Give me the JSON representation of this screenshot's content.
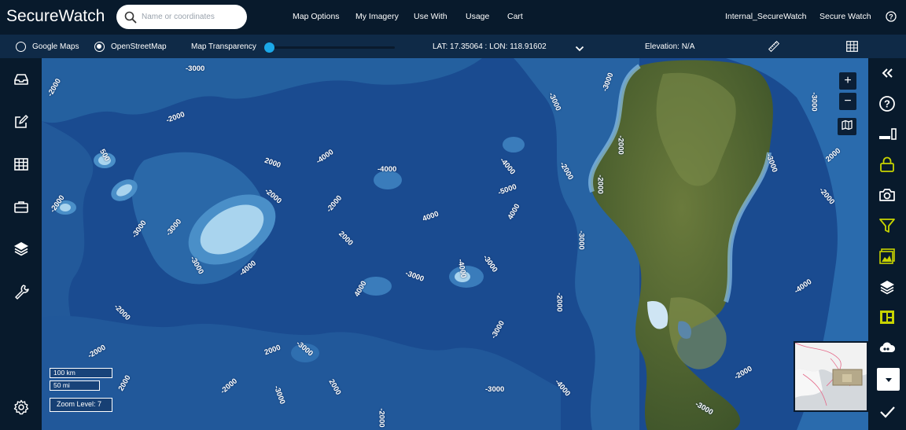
{
  "app": {
    "logo": "SecureWatch"
  },
  "search": {
    "placeholder": "Name or coordinates"
  },
  "nav": {
    "items": [
      "Map Options",
      "My Imagery",
      "Use With",
      "Usage",
      "Cart"
    ],
    "account": "Internal_SecureWatch",
    "product": "Secure Watch"
  },
  "toolbar": {
    "basemap_google": "Google Maps",
    "basemap_osm": "OpenStreetMap",
    "selected_basemap": "OpenStreetMap",
    "transparency_label": "Map Transparency",
    "transparency_value": 0.02,
    "coordinates": "LAT: 17.35064 : LON: 118.91602",
    "elevation": "Elevation: N/A"
  },
  "map": {
    "zoom_in": "+",
    "zoom_out": "−",
    "scale_km": "100 km",
    "scale_mi": "50 mi",
    "zoom_level": "Zoom Level: 7",
    "contours": [
      "-3000",
      "-2000",
      "-2000",
      "500",
      "-2000",
      "-3000",
      "-2000",
      "2000",
      "-4000",
      "-4000",
      "-2000",
      "-3000",
      "4000",
      "-4000",
      "-3000",
      "4000",
      "-4000",
      "-2000",
      "-2000",
      "4000",
      "-3000",
      "-4000",
      "-3000",
      "-3000",
      "-2000",
      "-3000",
      "-2000",
      "-3000",
      "-2000",
      "-3000",
      "2000",
      "-3000",
      "-2000",
      "-4000",
      "2000",
      "-3000",
      "-2000",
      "2000",
      "-3000",
      "2000",
      "-3000",
      "-4000",
      "-3000",
      "-2000",
      "-5000",
      "-2000",
      "-2000",
      "-3000",
      "2000"
    ]
  },
  "colors": {
    "topbar": "#081a2c",
    "toolbar": "#0f2a47",
    "accent": "#1ba8e8",
    "highlight": "#c8d400",
    "ocean_deep": "#1b4d92"
  },
  "icons": {
    "left": [
      "inbox-icon",
      "edit-icon",
      "table-icon",
      "briefcase-icon",
      "layers-icon",
      "wrench-icon",
      "gear-icon"
    ],
    "right": [
      "double-chevron-left-icon",
      "help-icon",
      "signal-icon",
      "lock-icon",
      "camera-icon",
      "filter-icon",
      "image-icon",
      "layers-icon",
      "compare-icon",
      "cloud-icon",
      "dropdown-icon",
      "check-icon"
    ]
  }
}
